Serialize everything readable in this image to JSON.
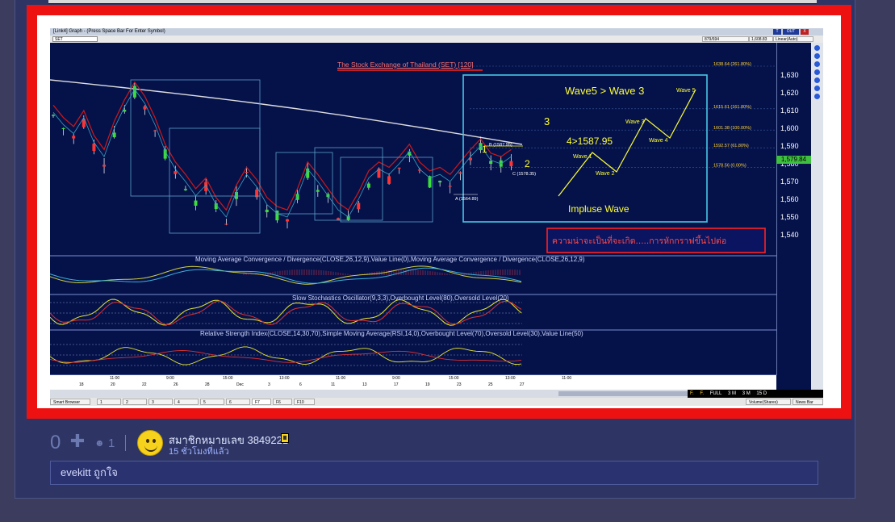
{
  "window": {
    "title": "[Link4] Graph - (Press Space Bar For Enter Symbol)",
    "buttons": [
      "T",
      "OUT",
      "X"
    ],
    "symbol": "SET",
    "field1": "879/694",
    "field2": "1,608.83",
    "field3": "Linear(Auto)"
  },
  "chart": {
    "title": "The Stock Exchange of Thailand (SET) [120]",
    "last_price": "1,579.84",
    "price_ticks": [
      "1,630",
      "1,620",
      "1,610",
      "1,600",
      "1,590",
      "1,580",
      "1,570",
      "1,560",
      "1,550",
      "1,540"
    ],
    "fib_levels": [
      {
        "price": 1635,
        "label": "1638.64 (261.80%)"
      },
      {
        "price": 1611,
        "label": "1615.61 (161.80%)"
      },
      {
        "price": 1599,
        "label": "1601.38 (100.00%)"
      },
      {
        "price": 1589,
        "label": "1592.57 (61.80%)"
      },
      {
        "price": 1578,
        "label": "1578.56 (0.00%)"
      }
    ],
    "point_labels": {
      "b": "B (1587.95)",
      "c": "C (1578.35)",
      "a": "A (1564.89)"
    },
    "wave_numbers": {
      "one": "1",
      "two": "2",
      "three": "3"
    },
    "annotations": {
      "header": "Wave5 > Wave 3",
      "condition": "4>1587.95",
      "wave_type": "Impluse Wave",
      "wave_labels": {
        "w1": "Wave 1",
        "w2": "Wave 2",
        "w3": "Wave 3",
        "w4": "Wave 4",
        "w5": "Wave 5"
      },
      "thai_note": "ความน่าจะเป็นที่จะเกิด.....การหักกราฟขึ้นไปต่อ"
    },
    "colors": {
      "background": "#05124a",
      "up_candle": "#3ddc3d",
      "down_candle": "#ff3333",
      "ma_red": "#d01818",
      "ma_white": "#dddddd",
      "annotation_box": "#48c6e6",
      "annotation_text": "#ffff33",
      "red_box": "#ff2020"
    }
  },
  "panels": {
    "macd": {
      "title": "Moving Average Convergence / Divergence(CLOSE,26,12,9),Value Line(0),Moving Average Convergence / Divergence(CLOSE,26,12,9)",
      "ticks": [
        "1",
        "-4",
        "-9"
      ]
    },
    "stoch": {
      "title": "Slow Stochastics Oscillator(9,3,3),Overbought Level(80),Oversold Level(20)",
      "ticks": [
        "80",
        "50",
        "20"
      ]
    },
    "rsi": {
      "title": "Relative Strength Index(CLOSE,14,30,70),Simple Moving Average(RSI,14,0),Overbought Level(70),Oversold Level(30),Value Line(50)",
      "ticks": [
        "80",
        "60",
        "40",
        "20"
      ]
    }
  },
  "timeaxis": {
    "upper": [
      "11:00",
      "9:00",
      "15:00",
      "13:00",
      "11:00",
      "9:00",
      "15:00",
      "13:00",
      "11:00"
    ],
    "lower": [
      "18",
      "20",
      "22",
      "26",
      "28",
      "Dec",
      "3",
      "6",
      "11",
      "13",
      "17",
      "19",
      "23",
      "25",
      "27"
    ]
  },
  "scrollbar": {
    "items": [
      "F.",
      "F.",
      "FULL",
      "3 M",
      "3 M",
      "15 D"
    ]
  },
  "bottombar": {
    "smart_browser": "Smart Browser",
    "tabs": [
      "1",
      "2",
      "3",
      "4",
      "5",
      "6",
      "F7",
      "F6",
      "F10"
    ],
    "volume": "Volume(Shares)",
    "newsbar": "News Bar"
  },
  "post": {
    "votes": "0",
    "reaction_count": "1",
    "username": "สมาชิกหมายเลข 3849221",
    "time_ago": "15 ชั่วโมงที่แล้ว",
    "comment": "evekitt ถูกใจ"
  }
}
